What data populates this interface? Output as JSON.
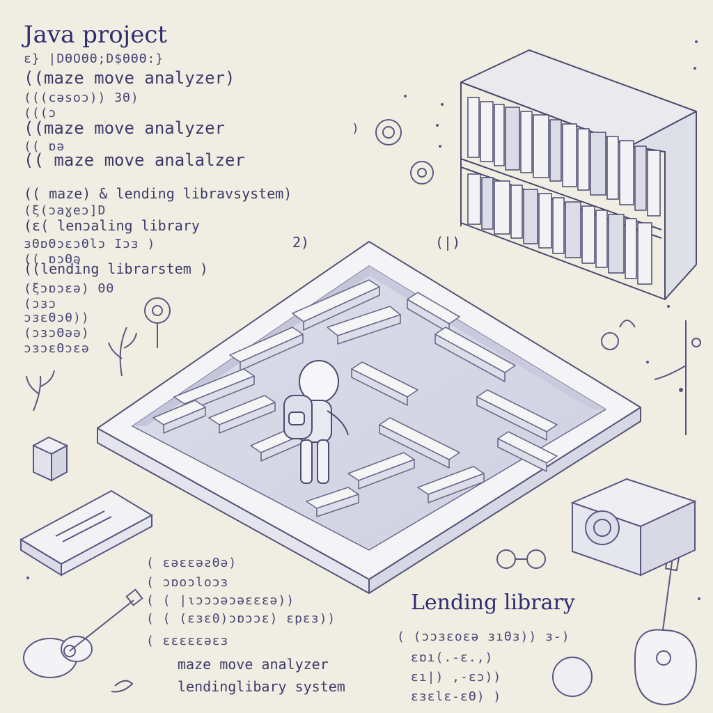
{
  "title": "Java project",
  "left_code": [
    "ε} |DΘOΘΘ;D$ΘΘΘ:}",
    "((maze move analyzer)",
    "(((cəsoɔ)) 3Θ)",
    "(((ɔ",
    "((maze move analyzer",
    ")",
    "((  ɒə",
    "(( maze   move   analalzer",
    "(( maze)   &  lending libravsystem)",
    "(ξ(ɔaɣeɔ]D",
    "(ɛ( lenɔaling library",
    "ɜΘɒΘɔɛɔΘlɔ  Ιɔɜ   )",
    "(( ɒɔΘə",
    "((lending librarstem  )",
    "(ξɔɒɔεə) ΘΘ",
    "(ɔɜɔ",
    "ɔɜɛΘɔθ))",
    "(ɔɜɔΘəə)",
    "ɔɜɔɛΘɔɛə",
    "2)",
    "(|)"
  ],
  "bottom_code": [
    "( ɛəɛɛəƨΘə)",
    "( ɔɒoɔloɔɜ",
    "( ( |ιɔɔɔəɔəɛɛɛə))",
    "( ( (ɛɜɛ0)ɔɒɔɔɛ) ɛpɛɜ))",
    "( ɛɛɛɛɛəɛɜ",
    "maze move analyzer",
    "lendinglibary system"
  ],
  "right_label": "Lending library",
  "right_code": [
    "( (ɔɔɜɛoɛə  ɜıΘɜ)) ɜ-)",
    "ɛɒı(.-ɛ.,)",
    "ɛı|) ,-ɛɔ))",
    "ɛɜɛlɛ-ɛΘ)  )"
  ]
}
